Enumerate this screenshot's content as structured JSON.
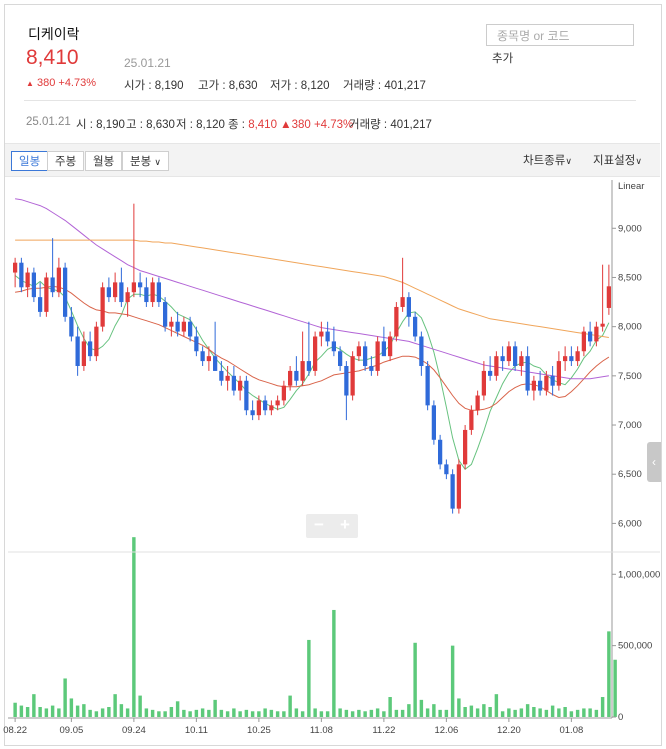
{
  "stock": {
    "name": "디케이락",
    "price": "8,410",
    "date": "25.01.21",
    "change": "380 +4.73%",
    "open": "시가 : 8,190",
    "high": "고가 : 8,630",
    "low": "저가 : 8,120",
    "volume": "거래량 : 401,217"
  },
  "search": {
    "placeholder": "종목명 or 코드",
    "add_label": "추가"
  },
  "info_bar": {
    "date": "25.01.21",
    "open": "시 : 8,190",
    "high": "고 : 8,630",
    "low": "저 : 8,120",
    "close_label": "종 :",
    "close": "8,410",
    "change": "380",
    "pct": "+4.73%",
    "volume": "거래량 : 401,217"
  },
  "toolbar": {
    "period_tabs": [
      "일봉",
      "주봉",
      "월봉",
      "분봉"
    ],
    "chart_type": "차트종류",
    "indicator": "지표설정"
  },
  "colors": {
    "up": "#e03a3a",
    "down": "#2f6ad9",
    "volume": "#5cc97a",
    "ma5": "#67c27f",
    "ma20": "#d9644a",
    "ma60": "#b264d6",
    "ma120": "#f0a55a"
  },
  "chart_data": [
    {
      "type": "candlestick",
      "scale_label": "Linear",
      "ylim": [
        5750,
        9450
      ],
      "yticks": [
        6000,
        6500,
        7000,
        7500,
        8000,
        8500,
        9000
      ],
      "ytick_labels": [
        "6,000",
        "6,500",
        "7,000",
        "7,500",
        "8,000",
        "8,500",
        "9,000"
      ],
      "xticks": [
        "08.22",
        "09.05",
        "09.24",
        "10.11",
        "10.25",
        "11.08",
        "11.22",
        "12.06",
        "12.20",
        "01.08"
      ],
      "xtick_index": [
        0,
        9,
        19,
        29,
        39,
        49,
        59,
        69,
        79,
        89
      ],
      "ohlc": [
        [
          8550,
          8700,
          8400,
          8650
        ],
        [
          8650,
          8700,
          8350,
          8400
        ],
        [
          8400,
          8600,
          8300,
          8550
        ],
        [
          8550,
          8600,
          8250,
          8300
        ],
        [
          8300,
          8450,
          8100,
          8150
        ],
        [
          8150,
          8550,
          8100,
          8500
        ],
        [
          8500,
          8900,
          8300,
          8350
        ],
        [
          8350,
          8700,
          8300,
          8600
        ],
        [
          8600,
          8650,
          8050,
          8100
        ],
        [
          8100,
          8200,
          7850,
          7900
        ],
        [
          7900,
          8000,
          7500,
          7600
        ],
        [
          7600,
          7950,
          7550,
          7850
        ],
        [
          7850,
          7950,
          7650,
          7700
        ],
        [
          7700,
          8050,
          7650,
          8000
        ],
        [
          8000,
          8450,
          7950,
          8400
        ],
        [
          8400,
          8500,
          8250,
          8300
        ],
        [
          8300,
          8550,
          8250,
          8450
        ],
        [
          8450,
          8600,
          8200,
          8250
        ],
        [
          8250,
          8400,
          8100,
          8350
        ],
        [
          8350,
          9250,
          8300,
          8450
        ],
        [
          8450,
          8550,
          8300,
          8400
        ],
        [
          8400,
          8500,
          8200,
          8250
        ],
        [
          8250,
          8500,
          8200,
          8450
        ],
        [
          8450,
          8500,
          8200,
          8250
        ],
        [
          8250,
          8300,
          7950,
          8000
        ],
        [
          8000,
          8100,
          7900,
          8050
        ],
        [
          8050,
          8150,
          7900,
          7950
        ],
        [
          7950,
          8100,
          7900,
          8050
        ],
        [
          8050,
          8100,
          7850,
          7900
        ],
        [
          7900,
          8000,
          7700,
          7750
        ],
        [
          7750,
          7800,
          7600,
          7650
        ],
        [
          7650,
          7800,
          7550,
          7700
        ],
        [
          7700,
          8050,
          7550,
          7550
        ],
        [
          7550,
          7650,
          7400,
          7450
        ],
        [
          7450,
          7600,
          7350,
          7500
        ],
        [
          7500,
          7600,
          7300,
          7350
        ],
        [
          7350,
          7500,
          7250,
          7450
        ],
        [
          7450,
          7500,
          7100,
          7150
        ],
        [
          7150,
          7250,
          7050,
          7100
        ],
        [
          7100,
          7300,
          7050,
          7250
        ],
        [
          7250,
          7300,
          7100,
          7150
        ],
        [
          7150,
          7250,
          7100,
          7200
        ],
        [
          7200,
          7300,
          7150,
          7250
        ],
        [
          7250,
          7450,
          7200,
          7400
        ],
        [
          7400,
          7600,
          7350,
          7550
        ],
        [
          7550,
          7700,
          7400,
          7450
        ],
        [
          7450,
          7950,
          7400,
          7650
        ],
        [
          7650,
          8050,
          7500,
          7550
        ],
        [
          7550,
          7950,
          7500,
          7900
        ],
        [
          7900,
          8050,
          7800,
          7950
        ],
        [
          7950,
          8050,
          7800,
          7850
        ],
        [
          7850,
          8000,
          7700,
          7750
        ],
        [
          7750,
          7800,
          7550,
          7600
        ],
        [
          7600,
          7650,
          7050,
          7300
        ],
        [
          7300,
          7750,
          7250,
          7700
        ],
        [
          7700,
          7850,
          7650,
          7800
        ],
        [
          7800,
          7850,
          7550,
          7600
        ],
        [
          7600,
          7700,
          7500,
          7550
        ],
        [
          7550,
          7900,
          7500,
          7850
        ],
        [
          7850,
          8000,
          7750,
          7700
        ],
        [
          7700,
          7950,
          7650,
          7900
        ],
        [
          7900,
          8250,
          7850,
          8200
        ],
        [
          8200,
          8700,
          8150,
          8300
        ],
        [
          8300,
          8350,
          8000,
          8100
        ],
        [
          8100,
          8150,
          7850,
          7900
        ],
        [
          7900,
          7950,
          7500,
          7600
        ],
        [
          7600,
          7650,
          7150,
          7200
        ],
        [
          7200,
          7250,
          6800,
          6850
        ],
        [
          6850,
          6900,
          6550,
          6600
        ],
        [
          6600,
          6650,
          6450,
          6500
        ],
        [
          6500,
          6550,
          6100,
          6150
        ],
        [
          6150,
          6650,
          6100,
          6600
        ],
        [
          6600,
          7000,
          6550,
          6950
        ],
        [
          6950,
          7200,
          6900,
          7150
        ],
        [
          7150,
          7350,
          7100,
          7300
        ],
        [
          7300,
          7650,
          7250,
          7550
        ],
        [
          7550,
          7700,
          7450,
          7500
        ],
        [
          7500,
          7750,
          7450,
          7700
        ],
        [
          7700,
          7800,
          7550,
          7650
        ],
        [
          7650,
          7850,
          7600,
          7800
        ],
        [
          7800,
          7850,
          7550,
          7600
        ],
        [
          7600,
          7750,
          7500,
          7700
        ],
        [
          7700,
          7800,
          7300,
          7350
        ],
        [
          7350,
          7500,
          7250,
          7450
        ],
        [
          7450,
          7550,
          7300,
          7350
        ],
        [
          7350,
          7550,
          7300,
          7500
        ],
        [
          7500,
          7600,
          7300,
          7400
        ],
        [
          7400,
          7750,
          7350,
          7650
        ],
        [
          7650,
          7800,
          7550,
          7700
        ],
        [
          7700,
          7800,
          7600,
          7650
        ],
        [
          7650,
          7800,
          7600,
          7750
        ],
        [
          7750,
          8000,
          7700,
          7950
        ],
        [
          7950,
          8050,
          7800,
          7850
        ],
        [
          7850,
          8050,
          7800,
          8000
        ],
        [
          8000,
          8630,
          7950,
          8030
        ],
        [
          8190,
          8630,
          8120,
          8410
        ]
      ],
      "overlays": [
        {
          "name": "MA5",
          "values": [
            8520,
            8470,
            8440,
            8410,
            8460,
            8400,
            8380,
            8360,
            8300,
            8160,
            8010,
            7880,
            7780,
            7760,
            7800,
            7870,
            8010,
            8120,
            8280,
            8330,
            8330,
            8310,
            8330,
            8310,
            8260,
            8200,
            8130,
            8100,
            8070,
            7970,
            7860,
            7770,
            7680,
            7610,
            7540,
            7480,
            7420,
            7350,
            7300,
            7260,
            7220,
            7190,
            7160,
            7180,
            7260,
            7350,
            7420,
            7520,
            7640,
            7700,
            7770,
            7800,
            7770,
            7720,
            7680,
            7660,
            7660,
            7680,
            7700,
            7750,
            7810,
            7940,
            8050,
            8140,
            8150,
            8090,
            7940,
            7740,
            7480,
            7180,
            6870,
            6640,
            6550,
            6600,
            6760,
            6940,
            7140,
            7280,
            7420,
            7530,
            7600,
            7630,
            7640,
            7600,
            7580,
            7510,
            7460,
            7430,
            7410,
            7480,
            7570,
            7680,
            7750,
            7860,
            7910,
            8040
          ]
        },
        {
          "name": "MA20",
          "values": [
            8350,
            8360,
            8380,
            8390,
            8390,
            8400,
            8410,
            8400,
            8380,
            8340,
            8290,
            8240,
            8200,
            8170,
            8160,
            8140,
            8140,
            8130,
            8120,
            8100,
            8080,
            8060,
            8040,
            8020,
            7990,
            7960,
            7930,
            7900,
            7870,
            7840,
            7810,
            7770,
            7720,
            7680,
            7650,
            7610,
            7570,
            7530,
            7490,
            7460,
            7440,
            7420,
            7400,
            7390,
            7390,
            7390,
            7400,
            7410,
            7430,
            7450,
            7480,
            7510,
            7520,
            7530,
            7540,
            7550,
            7570,
            7590,
            7610,
            7640,
            7660,
            7680,
            7700,
            7700,
            7690,
            7660,
            7620,
            7560,
            7480,
            7390,
            7300,
            7220,
            7170,
            7150,
            7150,
            7160,
            7180,
            7220,
            7280,
            7340,
            7380,
            7410,
            7420,
            7410,
            7390,
            7350,
            7310,
            7280,
            7290,
            7340,
            7400,
            7470,
            7540,
            7600,
            7650,
            7690
          ]
        },
        {
          "name": "MA60",
          "values": [
            9300,
            9290,
            9270,
            9250,
            9230,
            9200,
            9160,
            9120,
            9080,
            9030,
            8980,
            8930,
            8880,
            8830,
            8790,
            8750,
            8710,
            8670,
            8630,
            8600,
            8570,
            8550,
            8530,
            8510,
            8490,
            8470,
            8450,
            8430,
            8410,
            8390,
            8370,
            8350,
            8330,
            8310,
            8290,
            8270,
            8250,
            8230,
            8210,
            8190,
            8170,
            8150,
            8130,
            8110,
            8090,
            8070,
            8050,
            8030,
            8010,
            7990,
            7980,
            7970,
            7960,
            7950,
            7940,
            7930,
            7920,
            7910,
            7900,
            7890,
            7880,
            7870,
            7860,
            7850,
            7830,
            7810,
            7790,
            7770,
            7750,
            7730,
            7710,
            7690,
            7670,
            7650,
            7630,
            7610,
            7600,
            7590,
            7580,
            7570,
            7560,
            7550,
            7540,
            7530,
            7520,
            7510,
            7500,
            7490,
            7480,
            7470,
            7470,
            7470,
            7470,
            7480,
            7490,
            7500
          ]
        },
        {
          "name": "MA120",
          "values": [
            8880,
            8880,
            8880,
            8880,
            8880,
            8880,
            8880,
            8880,
            8880,
            8880,
            8880,
            8880,
            8880,
            8880,
            8880,
            8880,
            8880,
            8880,
            8880,
            8880,
            8870,
            8870,
            8860,
            8860,
            8850,
            8850,
            8840,
            8830,
            8820,
            8810,
            8800,
            8790,
            8780,
            8770,
            8760,
            8750,
            8740,
            8730,
            8720,
            8710,
            8700,
            8690,
            8680,
            8670,
            8660,
            8650,
            8640,
            8630,
            8620,
            8610,
            8600,
            8590,
            8580,
            8570,
            8560,
            8550,
            8540,
            8530,
            8520,
            8510,
            8490,
            8470,
            8450,
            8420,
            8390,
            8360,
            8330,
            8300,
            8270,
            8240,
            8210,
            8180,
            8160,
            8140,
            8120,
            8100,
            8080,
            8070,
            8060,
            8050,
            8040,
            8030,
            8020,
            8010,
            8000,
            7990,
            7980,
            7970,
            7960,
            7950,
            7940,
            7930,
            7920,
            7910,
            7900,
            7890
          ]
        }
      ]
    },
    {
      "type": "bar",
      "name": "거래량",
      "ylim": [
        0,
        1100000
      ],
      "yticks": [
        0,
        500000,
        1000000
      ],
      "ytick_labels": [
        "0",
        "500,000",
        "1,000,000"
      ],
      "values": [
        100000,
        80000,
        70000,
        160000,
        70000,
        60000,
        80000,
        60000,
        270000,
        130000,
        80000,
        90000,
        50000,
        40000,
        60000,
        70000,
        160000,
        90000,
        60000,
        1260000,
        150000,
        60000,
        50000,
        40000,
        40000,
        70000,
        110000,
        50000,
        40000,
        50000,
        60000,
        50000,
        120000,
        50000,
        40000,
        60000,
        40000,
        50000,
        40000,
        40000,
        60000,
        50000,
        40000,
        40000,
        150000,
        60000,
        40000,
        540000,
        60000,
        40000,
        40000,
        750000,
        60000,
        50000,
        40000,
        50000,
        40000,
        50000,
        60000,
        40000,
        140000,
        50000,
        50000,
        90000,
        520000,
        120000,
        60000,
        90000,
        50000,
        50000,
        500000,
        130000,
        70000,
        80000,
        60000,
        90000,
        70000,
        160000,
        40000,
        60000,
        50000,
        60000,
        90000,
        70000,
        60000,
        50000,
        80000,
        60000,
        70000,
        40000,
        50000,
        60000,
        60000,
        50000,
        140000,
        600000,
        401217
      ]
    }
  ]
}
